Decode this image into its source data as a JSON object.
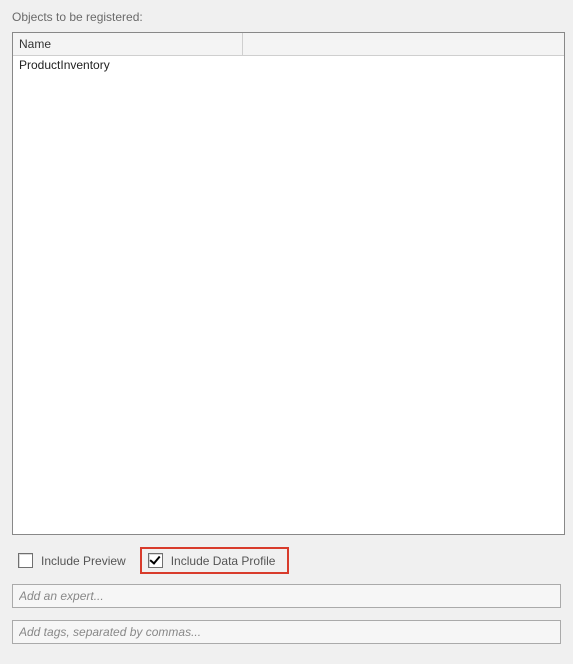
{
  "section_label": "Objects to be registered:",
  "table": {
    "columns": [
      "Name",
      ""
    ],
    "rows": [
      {
        "name": "ProductInventory"
      }
    ]
  },
  "options": {
    "include_preview": {
      "label": "Include Preview",
      "checked": false
    },
    "include_data_profile": {
      "label": "Include Data Profile",
      "checked": true
    }
  },
  "expert_input": {
    "placeholder": "Add an expert...",
    "value": ""
  },
  "tags_input": {
    "placeholder": "Add tags, separated by commas...",
    "value": ""
  }
}
